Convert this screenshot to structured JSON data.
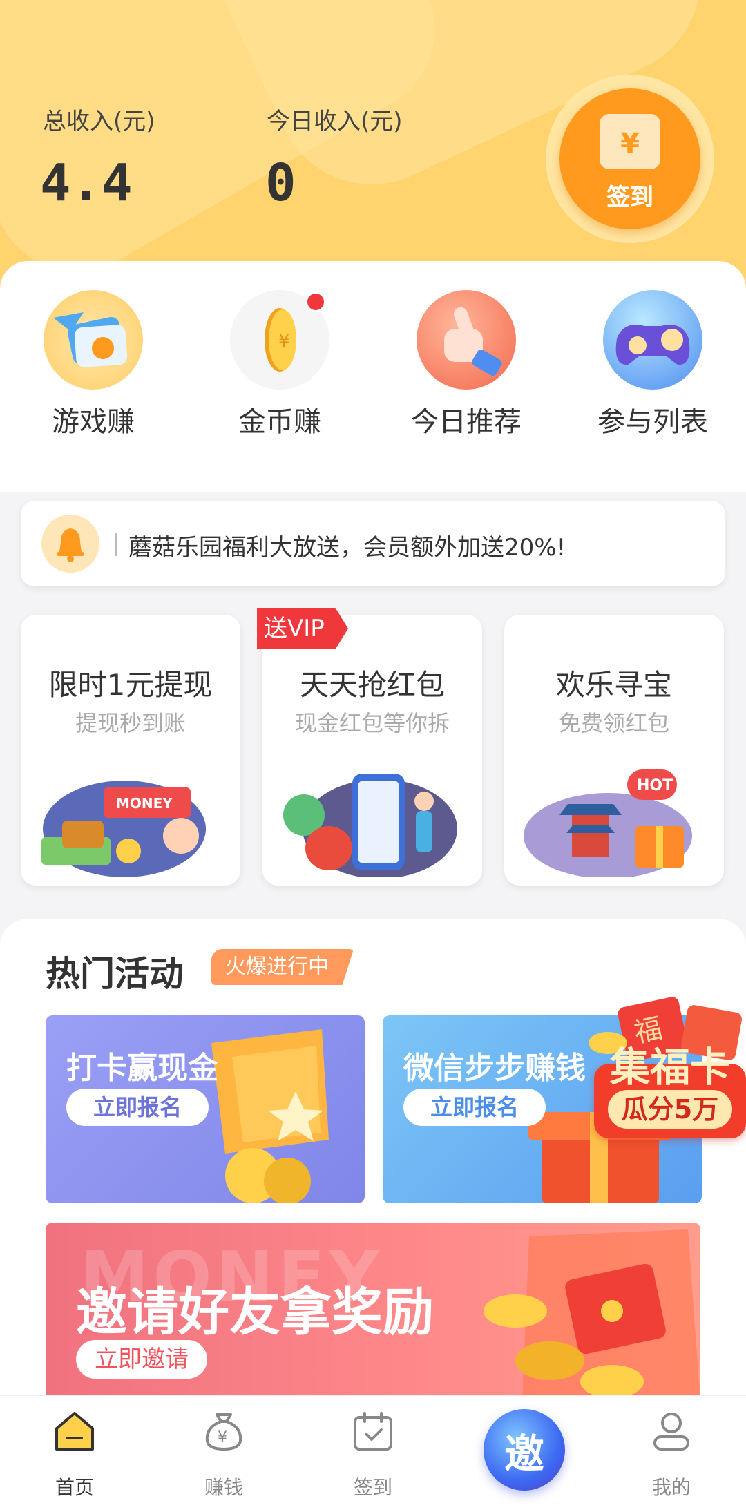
{
  "header": {
    "total_income_label": "总收入(元)",
    "total_income_value": "4.4",
    "today_income_label": "今日收入(元)",
    "today_income_value": "0",
    "sign_in_label": "签到",
    "sign_in_icon": "calendar-yen-icon"
  },
  "quick_entries": [
    {
      "label": "游戏赚",
      "icon": "game-card-icon",
      "badge": false
    },
    {
      "label": "金币赚",
      "icon": "coin-icon",
      "badge": true
    },
    {
      "label": "今日推荐",
      "icon": "thumbs-up-icon",
      "badge": false
    },
    {
      "label": "参与列表",
      "icon": "gamepad-icon",
      "badge": false
    }
  ],
  "notice": {
    "icon": "bell-icon",
    "text": "蘑菇乐园福利大放送，会员额外加送20%!"
  },
  "promo_cards": [
    {
      "title": "限时1元提现",
      "subtitle": "提现秒到账",
      "art_text": "MONEY"
    },
    {
      "title": "天天抢红包",
      "subtitle": "现金红包等你拆",
      "badge": "送VIP"
    },
    {
      "title": "欢乐寻宝",
      "subtitle": "免费领红包",
      "art_text": "HOT"
    }
  ],
  "hot_activity": {
    "title": "热门活动",
    "tag": "火爆进行中",
    "banners": [
      {
        "title": "打卡赢现金",
        "button": "立即报名",
        "color": "#8a8ff0"
      },
      {
        "title": "微信步步赚钱",
        "button": "立即报名",
        "color": "#6ab7f2"
      }
    ],
    "invite": {
      "title": "邀请好友拿奖励",
      "button": "立即邀请",
      "bg_text": "MONEY"
    },
    "floating": {
      "title": "集福卡",
      "subtitle": "瓜分5万",
      "fu_char": "福"
    }
  },
  "tabbar": {
    "items": [
      {
        "label": "首页",
        "icon": "home-icon",
        "active": true
      },
      {
        "label": "赚钱",
        "icon": "money-bag-icon",
        "active": false
      },
      {
        "label": "签到",
        "icon": "calendar-check-icon",
        "active": false
      },
      {
        "label": "邀",
        "icon": "invite-icon",
        "active": false
      },
      {
        "label": "我的",
        "icon": "user-icon",
        "active": false
      }
    ]
  },
  "colors": {
    "header_bg": "#ffd36e",
    "accent_orange": "#ff9a1e",
    "red": "#f0383c"
  }
}
